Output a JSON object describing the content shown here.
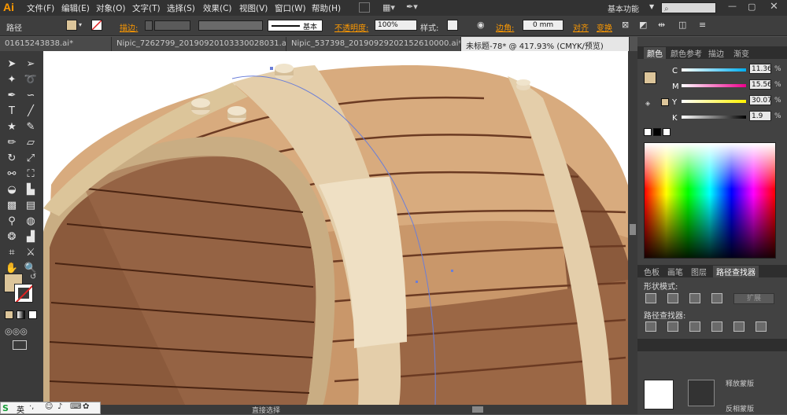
{
  "app": {
    "logo": "Ai",
    "workspace": "基本功能",
    "workspace_arrow": "▼"
  },
  "menu": [
    "文件(F)",
    "编辑(E)",
    "对象(O)",
    "文字(T)",
    "选择(S)",
    "效果(C)",
    "视图(V)",
    "窗口(W)",
    "帮助(H)"
  ],
  "control": {
    "type_label": "路径",
    "stroke_label": "描边:",
    "profile_label": "基本",
    "opacity_label": "不透明度:",
    "opacity_value": "100%",
    "style_label": "样式:",
    "corner_label": "边角:",
    "corner_value": "0 mm",
    "align_label": "对齐",
    "transform_label": "变换"
  },
  "tabs": [
    "01615243838.ai*",
    "Nipic_7262799_20190920103330028031.ai*",
    "Nipic_537398_20190929202152610000.ai*",
    "未标题-78* @ 417.93% (CMYK/预览)"
  ],
  "color_panel": {
    "tabs": [
      "颜色",
      "颜色参考",
      "描边",
      "渐变"
    ],
    "channels": [
      {
        "name": "C",
        "value": "11.36"
      },
      {
        "name": "M",
        "value": "15.56"
      },
      {
        "name": "Y",
        "value": "30.07"
      },
      {
        "name": "K",
        "value": "1.9"
      }
    ],
    "unit": "%"
  },
  "pathfinder_panel": {
    "tabs": [
      "色板",
      "画笔",
      "图层",
      "路径查找器"
    ],
    "shape_modes_label": "形状模式:",
    "expand_label": "扩展",
    "pathfinders_label": "路径查找器:"
  },
  "bottom_panel": {
    "reflect_label": "反相蒙版",
    "close_label": "释放蒙版"
  },
  "status": {
    "tool_name": "直接选择"
  },
  "ime": {
    "lang": "英"
  },
  "colors": {
    "fill": "#dcc59a",
    "barrel_light": "#d8ab7e",
    "barrel_dark": "#8b5a3c",
    "hoop": "#e4ceaa"
  }
}
